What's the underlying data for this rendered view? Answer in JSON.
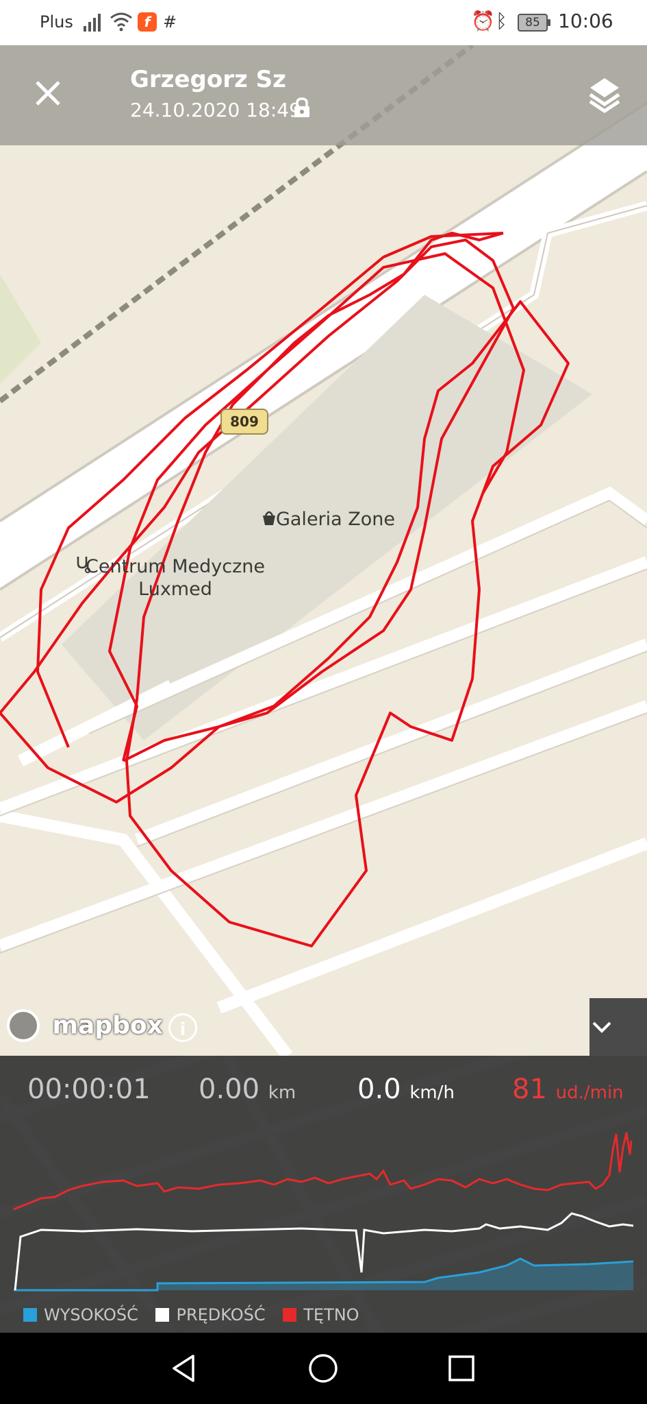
{
  "status_bar": {
    "carrier": "Plus",
    "battery": "85",
    "time": "10:06",
    "icons": [
      "signal-icon",
      "wifi-icon",
      "app-notification-icon",
      "slack-icon",
      "alarm-icon",
      "bluetooth-icon",
      "battery-icon"
    ]
  },
  "header": {
    "close_icon": "close-icon",
    "user_name": "Grzegorz Sz",
    "datetime": "24.10.2020 18:49",
    "privacy_icon": "lock-icon",
    "layers_icon": "layers-icon"
  },
  "map": {
    "road_number": "809",
    "pois": [
      {
        "name": "Galeria Zone",
        "icon": "shopping-bag-icon"
      },
      {
        "name": "Centrum Medyczne Luxmed",
        "icon": "stethoscope-icon"
      }
    ],
    "attribution": "mapbox",
    "route_color": "#e8101a"
  },
  "stats": {
    "duration": "00:00:01",
    "distance_value": "0.00",
    "distance_unit": "km",
    "speed_value": "0.0",
    "speed_unit": "km/h",
    "heart_rate_value": "81",
    "heart_rate_unit": "ud./min"
  },
  "legend": {
    "altitude": "WYSOKOŚĆ",
    "speed": "PRĘDKOŚĆ",
    "heart_rate": "TĘTNO"
  },
  "colors": {
    "altitude": "#2aa0d8",
    "speed": "#ffffff",
    "heart_rate": "#e62a2a"
  },
  "nav": {
    "back_icon": "back-icon",
    "home_icon": "home-icon",
    "recents_icon": "recents-icon"
  }
}
